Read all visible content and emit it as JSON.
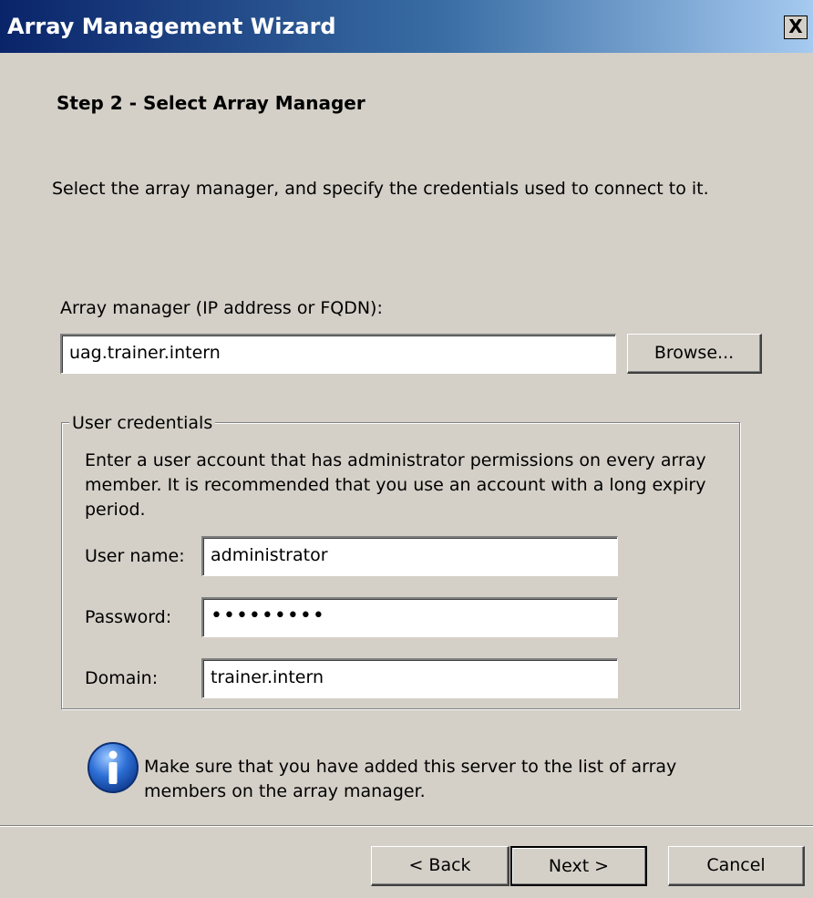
{
  "window": {
    "title": "Array Management Wizard",
    "close_label": "X"
  },
  "step": {
    "title": "Step 2 - Select Array Manager",
    "description": "Select the array manager, and specify the credentials used to connect to it."
  },
  "array_manager": {
    "label": "Array manager (IP address or FQDN):",
    "value": "uag.trainer.intern",
    "browse_label": "Browse..."
  },
  "credentials": {
    "group_label": "User credentials",
    "description": "Enter a user account that has administrator permissions on every array member. It is recommended that you use an account with a long expiry period.",
    "username_label": "User name:",
    "username_value": "administrator",
    "password_label": "Password:",
    "password_value": "•••••••••",
    "domain_label": "Domain:",
    "domain_value": "trainer.intern"
  },
  "info": {
    "icon": "information-icon",
    "text": "Make sure that you have added this server to the list of array members on the array manager."
  },
  "buttons": {
    "back": "< Back",
    "next": "Next >",
    "cancel": "Cancel"
  },
  "colors": {
    "titlebar_start": "#0a246a",
    "titlebar_end": "#a6caf0",
    "dialog_background": "#d4d0c8"
  }
}
